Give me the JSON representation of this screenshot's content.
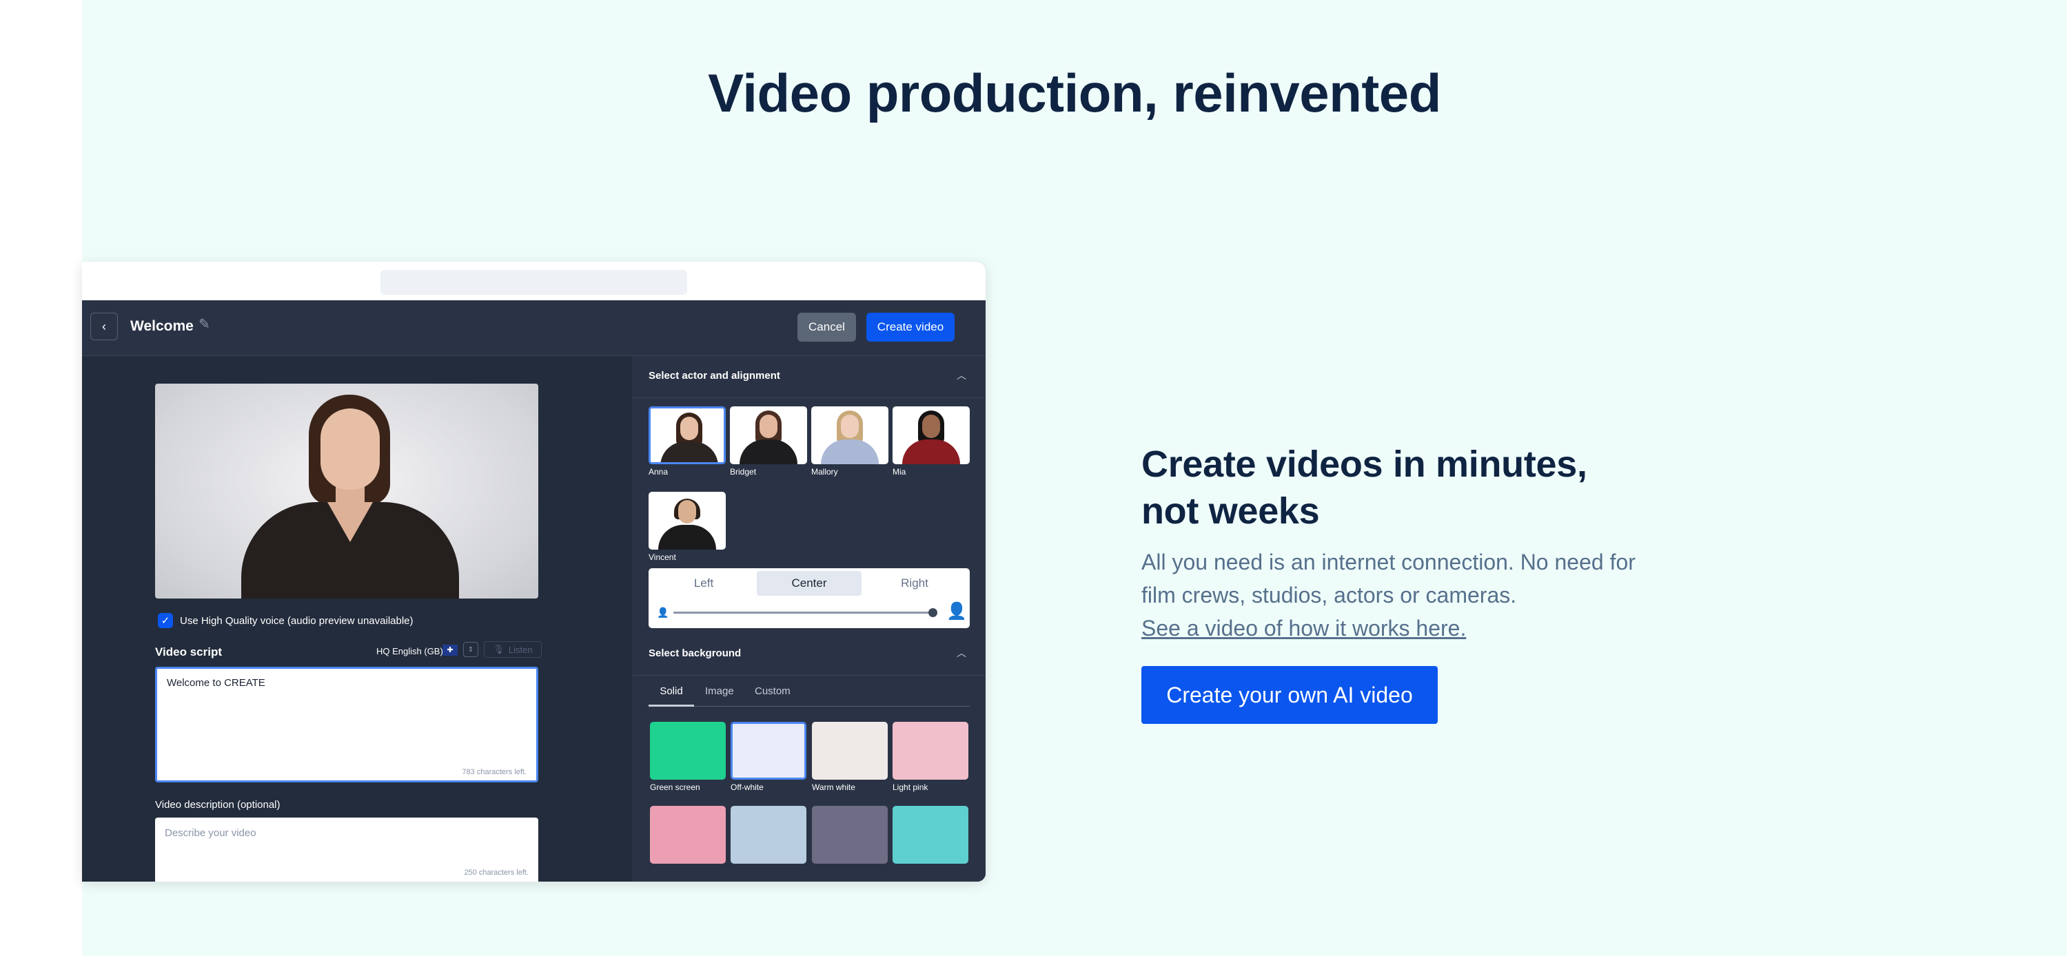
{
  "page": {
    "headline": "Video production, reinvented",
    "subheadline_line1": "Create videos in minutes,",
    "subheadline_line2": "not weeks",
    "body_line1": "All you need is an internet connection. No need for",
    "body_line2": "film crews, studios, actors or cameras.",
    "link_text": "See a video of how it works here.",
    "cta_label": "Create your own AI video"
  },
  "app": {
    "title": "Welcome",
    "back_icon": "chevron-left-icon",
    "edit_icon": "pencil-icon",
    "cancel_label": "Cancel",
    "create_label": "Create video",
    "hq_voice_label": "Use High Quality voice (audio preview unavailable)",
    "hq_voice_checked": true,
    "script_label": "Video script",
    "language": "HQ English (GB)",
    "flag": "🇬🇧",
    "listen_label": "Listen",
    "script_text": "Welcome to CREATE",
    "script_chars_left": "783 characters left.",
    "description_label": "Video description (optional)",
    "description_placeholder": "Describe your video",
    "description_chars_left": "250 characters left."
  },
  "actors": {
    "section_title": "Select actor and alignment",
    "items": [
      {
        "name": "Anna",
        "selected": true,
        "hair": "#3a2419",
        "skin": "#e7bfa6",
        "top": "#2a2523"
      },
      {
        "name": "Bridget",
        "selected": false,
        "hair": "#4a2e22",
        "skin": "#e4b89e",
        "top": "#1d1d1f"
      },
      {
        "name": "Mallory",
        "selected": false,
        "hair": "#c9a97a",
        "skin": "#efcfbb",
        "top": "#aab8d6"
      },
      {
        "name": "Mia",
        "selected": false,
        "hair": "#151212",
        "skin": "#9b6a4f",
        "top": "#8b1c22"
      },
      {
        "name": "Vincent",
        "selected": false,
        "hair": "#2b1f18",
        "skin": "#d9b08f",
        "top": "#1b1b1c"
      }
    ],
    "alignment_options": [
      "Left",
      "Center",
      "Right"
    ],
    "alignment_selected": "Center"
  },
  "background": {
    "section_title": "Select background",
    "tabs": [
      "Solid",
      "Image",
      "Custom"
    ],
    "active_tab": "Solid",
    "swatches": [
      {
        "name": "Green screen",
        "color": "#1fd290",
        "selected": false
      },
      {
        "name": "Off-white",
        "color": "#e9edfa",
        "selected": true
      },
      {
        "name": "Warm white",
        "color": "#efe9e8",
        "selected": false
      },
      {
        "name": "Light pink",
        "color": "#f1bfcb",
        "selected": false
      },
      {
        "name": "",
        "color": "#ec9fb3",
        "selected": false
      },
      {
        "name": "",
        "color": "#b9cee0",
        "selected": false
      },
      {
        "name": "",
        "color": "#6e6d85",
        "selected": false
      },
      {
        "name": "",
        "color": "#5ed0d0",
        "selected": false
      }
    ]
  },
  "colors": {
    "brand_blue": "#0a56ee",
    "navy": "#0f2342",
    "page_mint": "#effdfa",
    "app_dark": "#2a3345"
  }
}
